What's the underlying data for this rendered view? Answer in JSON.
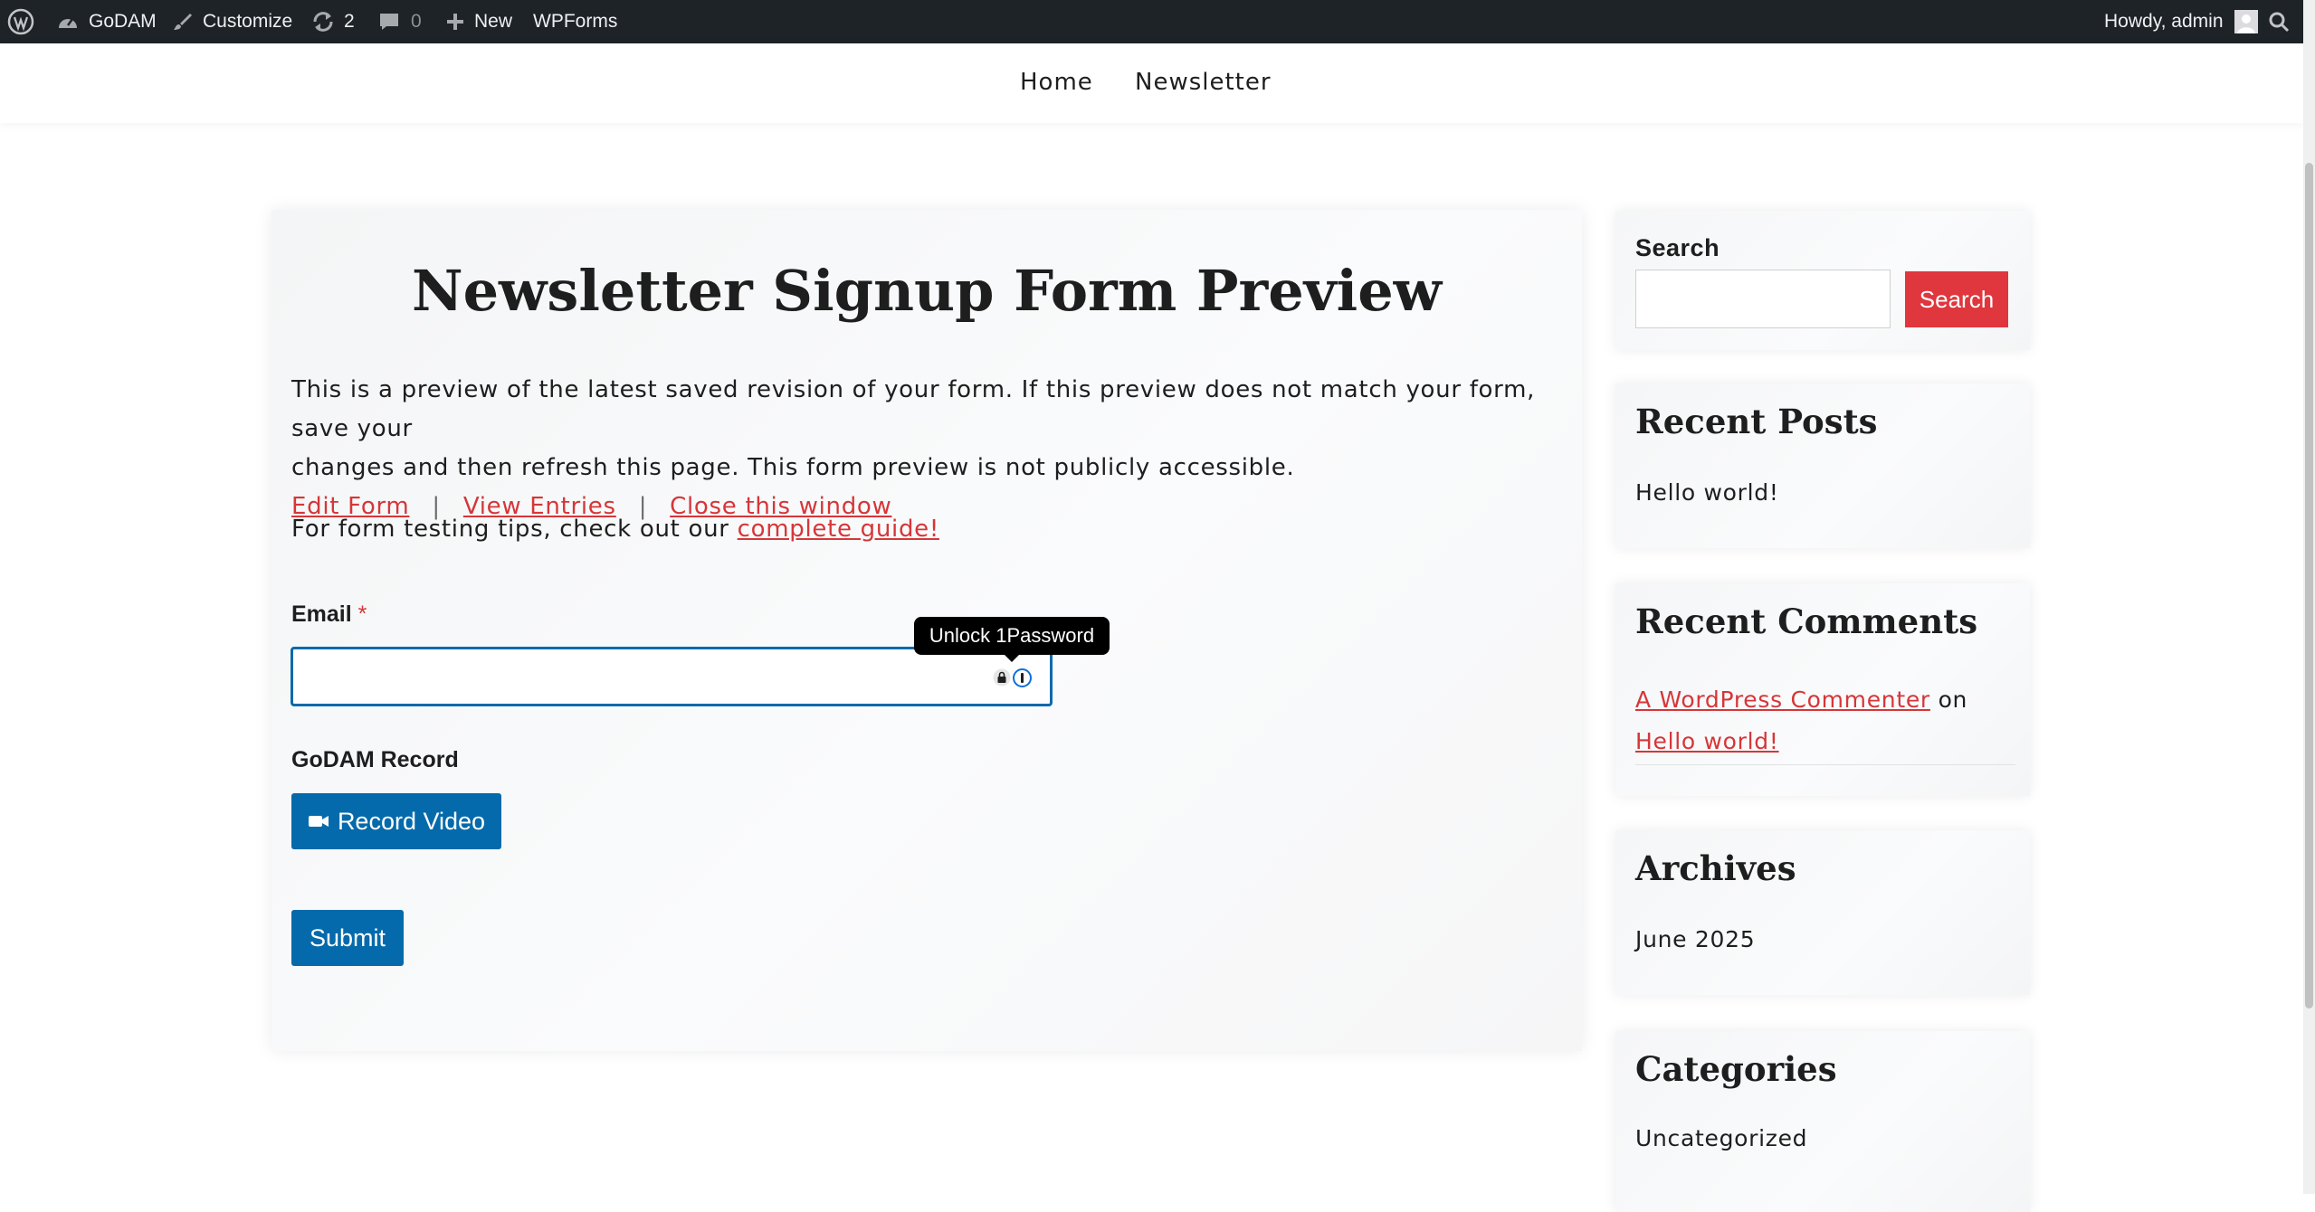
{
  "adminbar": {
    "site_name": "GoDAM",
    "customize": "Customize",
    "updates_count": "2",
    "comments_count": "0",
    "new": "New",
    "wpforms": "WPForms",
    "howdy": "Howdy, admin",
    "icons": [
      "wordpress-logo-icon",
      "dashboard-icon",
      "brush-icon",
      "refresh-icon",
      "comment-icon",
      "plus-icon",
      "avatar-icon",
      "search-icon"
    ]
  },
  "nav": {
    "items": [
      {
        "label": "Home"
      },
      {
        "label": "Newsletter"
      }
    ]
  },
  "main": {
    "title": "Newsletter Signup Form Preview",
    "preview_line1": "This is a preview of the latest saved revision of your form. If this preview does not match your form, save your",
    "preview_line2": "changes and then refresh this page. This form preview is not publicly accessible.",
    "links": {
      "edit": "Edit Form",
      "entries": "View Entries",
      "close": "Close this window",
      "separator": "|"
    },
    "tips_prefix": "For form testing tips, check out our",
    "tips_link": "complete guide!"
  },
  "form": {
    "email_label": "Email",
    "required_marker": "*",
    "email_value": "",
    "tooltip": "Unlock 1Password",
    "record_label": "GoDAM Record",
    "record_button": "Record Video",
    "submit": "Submit"
  },
  "sidebar": {
    "search_title": "Search",
    "search_button": "Search",
    "search_value": "",
    "recent_posts_title": "Recent Posts",
    "recent_posts": [
      "Hello world!"
    ],
    "recent_comments_title": "Recent Comments",
    "comment_author": "A WordPress Commenter",
    "comment_on": "on",
    "comment_post": "Hello world!",
    "archives_title": "Archives",
    "archives": [
      "June 2025"
    ],
    "categories_title": "Categories",
    "categories": [
      "Uncategorized"
    ]
  },
  "colors": {
    "accent_red": "#d63638",
    "button_blue": "#056aab",
    "adminbar_bg": "#1d2327",
    "search_button_bg": "#e0363d"
  }
}
